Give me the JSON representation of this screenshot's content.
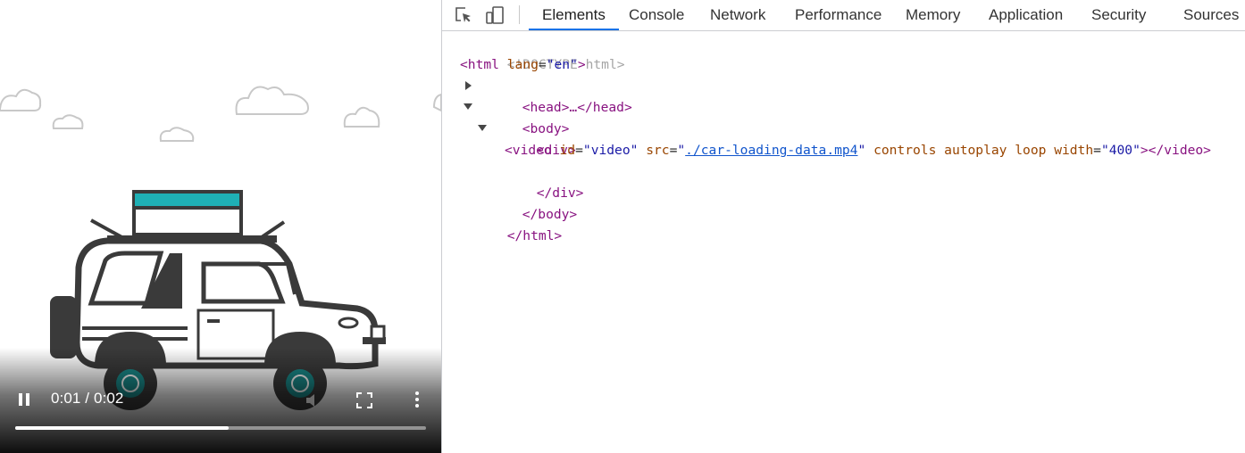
{
  "video": {
    "time_display": "0:01 / 0:02",
    "progress_fraction": 0.52,
    "playing": true,
    "colors": {
      "accent_teal": "#1fb0b5",
      "outline": "#3a3a3a",
      "wheel": "#1a8a8a"
    }
  },
  "devtools": {
    "toolbar_icons": [
      "inspect-element-icon",
      "device-toolbar-icon"
    ],
    "tabs": [
      {
        "label": "Elements",
        "active": true
      },
      {
        "label": "Console",
        "active": false
      },
      {
        "label": "Network",
        "active": false
      },
      {
        "label": "Performance",
        "active": false
      },
      {
        "label": "Memory",
        "active": false
      },
      {
        "label": "Application",
        "active": false
      },
      {
        "label": "Security",
        "active": false
      },
      {
        "label": "Sources",
        "active": false
      }
    ],
    "dom": {
      "doctype": "<!DOCTYPE html>",
      "html_open": {
        "tag": "html",
        "attr": "lang",
        "value": "en"
      },
      "head_collapsed": "<head>…</head>",
      "body_open": "<body>",
      "div_open": "<div>",
      "video_el": {
        "tag_open": "<video",
        "id_attr": "id",
        "id_value": "video",
        "src_attr": "src",
        "src_value": "./car-loading-data.mp4",
        "flag1": "controls",
        "flag2": "autoplay",
        "flag3": "loop",
        "width_attr": "width",
        "width_value": "400",
        "tag_close": "></video>"
      },
      "div_close": "</div>",
      "body_close": "</body>",
      "html_close": "</html>"
    },
    "colors": {
      "active_tab_underline": "#1a73e8",
      "tag": "#881280",
      "attr": "#994500",
      "value": "#1a1aa6"
    }
  }
}
